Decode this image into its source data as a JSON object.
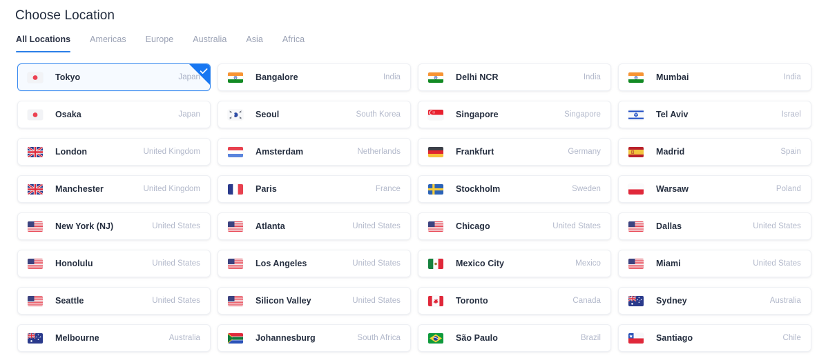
{
  "header": {
    "title": "Choose Location"
  },
  "tabs": [
    {
      "label": "All Locations",
      "active": true
    },
    {
      "label": "Americas",
      "active": false
    },
    {
      "label": "Europe",
      "active": false
    },
    {
      "label": "Australia",
      "active": false
    },
    {
      "label": "Asia",
      "active": false
    },
    {
      "label": "Africa",
      "active": false
    }
  ],
  "colors": {
    "accent": "#2a7fe8",
    "selected_border": "#3c8cf0",
    "selected_bg": "#f6faff",
    "badge_blue": "#1877f2",
    "city_text": "#262f40",
    "country_text": "#b3b9cb",
    "tab_inactive": "#9aa1b4",
    "card_border": "#eef0f4",
    "page_bg": "#ffffff"
  },
  "selection": {
    "selected_city": "Tokyo",
    "check_icon": "check-icon"
  },
  "locations": [
    {
      "city": "Tokyo",
      "country": "Japan",
      "flag": "jp",
      "selected": true
    },
    {
      "city": "Bangalore",
      "country": "India",
      "flag": "in",
      "selected": false
    },
    {
      "city": "Delhi NCR",
      "country": "India",
      "flag": "in",
      "selected": false
    },
    {
      "city": "Mumbai",
      "country": "India",
      "flag": "in",
      "selected": false
    },
    {
      "city": "Osaka",
      "country": "Japan",
      "flag": "jp",
      "selected": false
    },
    {
      "city": "Seoul",
      "country": "South Korea",
      "flag": "kr",
      "selected": false
    },
    {
      "city": "Singapore",
      "country": "Singapore",
      "flag": "sg",
      "selected": false
    },
    {
      "city": "Tel Aviv",
      "country": "Israel",
      "flag": "il",
      "selected": false
    },
    {
      "city": "London",
      "country": "United Kingdom",
      "flag": "gb",
      "selected": false
    },
    {
      "city": "Amsterdam",
      "country": "Netherlands",
      "flag": "nl",
      "selected": false
    },
    {
      "city": "Frankfurt",
      "country": "Germany",
      "flag": "de",
      "selected": false
    },
    {
      "city": "Madrid",
      "country": "Spain",
      "flag": "es",
      "selected": false
    },
    {
      "city": "Manchester",
      "country": "United Kingdom",
      "flag": "gb",
      "selected": false
    },
    {
      "city": "Paris",
      "country": "France",
      "flag": "fr",
      "selected": false
    },
    {
      "city": "Stockholm",
      "country": "Sweden",
      "flag": "se",
      "selected": false
    },
    {
      "city": "Warsaw",
      "country": "Poland",
      "flag": "pl",
      "selected": false
    },
    {
      "city": "New York (NJ)",
      "country": "United States",
      "flag": "us",
      "selected": false
    },
    {
      "city": "Atlanta",
      "country": "United States",
      "flag": "us",
      "selected": false
    },
    {
      "city": "Chicago",
      "country": "United States",
      "flag": "us",
      "selected": false
    },
    {
      "city": "Dallas",
      "country": "United States",
      "flag": "us",
      "selected": false
    },
    {
      "city": "Honolulu",
      "country": "United States",
      "flag": "us",
      "selected": false
    },
    {
      "city": "Los Angeles",
      "country": "United States",
      "flag": "us",
      "selected": false
    },
    {
      "city": "Mexico City",
      "country": "Mexico",
      "flag": "mx",
      "selected": false
    },
    {
      "city": "Miami",
      "country": "United States",
      "flag": "us",
      "selected": false
    },
    {
      "city": "Seattle",
      "country": "United States",
      "flag": "us",
      "selected": false
    },
    {
      "city": "Silicon Valley",
      "country": "United States",
      "flag": "us",
      "selected": false
    },
    {
      "city": "Toronto",
      "country": "Canada",
      "flag": "ca",
      "selected": false
    },
    {
      "city": "Sydney",
      "country": "Australia",
      "flag": "au",
      "selected": false
    },
    {
      "city": "Melbourne",
      "country": "Australia",
      "flag": "au",
      "selected": false
    },
    {
      "city": "Johannesburg",
      "country": "South Africa",
      "flag": "za",
      "selected": false
    },
    {
      "city": "São Paulo",
      "country": "Brazil",
      "flag": "br",
      "selected": false
    },
    {
      "city": "Santiago",
      "country": "Chile",
      "flag": "cl",
      "selected": false
    }
  ]
}
